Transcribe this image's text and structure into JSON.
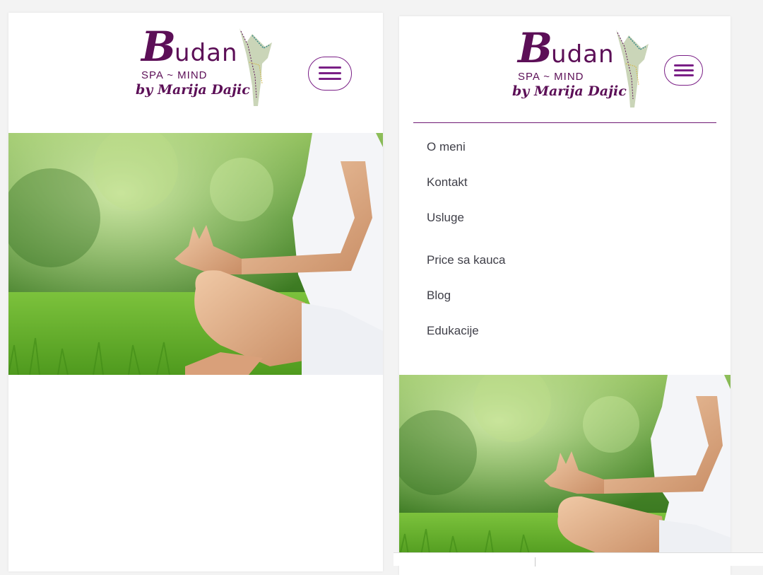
{
  "logo": {
    "word_initial": "B",
    "word_rest": "udan",
    "tagline": "SPA ~ MIND",
    "byline": "by Marija Dajic",
    "brand_color": "#5c0f57"
  },
  "menu_button": {
    "icon": "hamburger-menu-icon",
    "accent_color": "#7a1f86"
  },
  "hero": {
    "description_icon": "yoga-meditation-photo"
  },
  "nav": {
    "items": [
      {
        "label": "O meni"
      },
      {
        "label": "Kontakt"
      },
      {
        "label": "Usluge"
      },
      {
        "label": "Price sa kauca"
      },
      {
        "label": "Blog"
      },
      {
        "label": "Edukacije"
      }
    ],
    "text_color": "#3f3f48",
    "divider_color": "#6f1a74"
  }
}
